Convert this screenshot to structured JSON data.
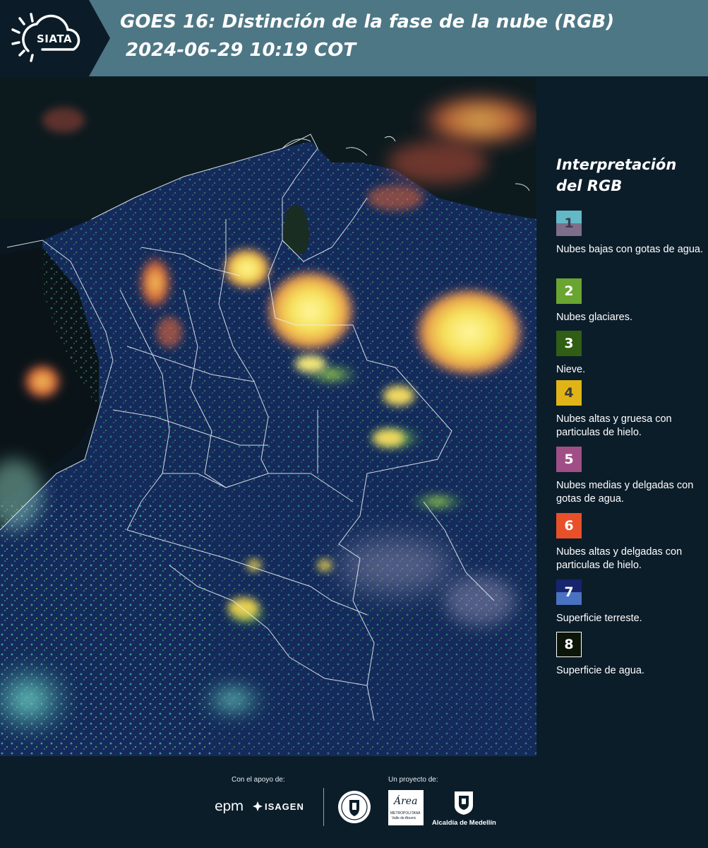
{
  "header": {
    "logo_text": "SIATA",
    "title": "GOES 16: Distinción de la fase de la nube (RGB)",
    "subtitle": "2024-06-29 10:19 COT"
  },
  "legend": {
    "title_line1": "Interpretación",
    "title_line2": "del RGB",
    "items": [
      {
        "number": "1",
        "label": "Nubes bajas con gotas de agua.",
        "color": "#64b9c6",
        "color2": "#7d6e8a"
      },
      {
        "number": "2",
        "label": "Nubes glaciares.",
        "color": "#6aa431"
      },
      {
        "number": "3",
        "label": "Nieve.",
        "color": "#2f5e14"
      },
      {
        "number": "4",
        "label": "Nubes altas y gruesa con particulas de hielo.",
        "color": "#e0b417"
      },
      {
        "number": "5",
        "label": "Nubes medias y delgadas con gotas de agua.",
        "color": "#a04f86"
      },
      {
        "number": "6",
        "label": "Nubes altas y delgadas con particulas de hielo.",
        "color": "#e8502a"
      },
      {
        "number": "7",
        "label": "Superficie terreste.",
        "color": "#16256e",
        "color2": "#4a72c2"
      },
      {
        "number": "8",
        "label": "Superficie de agua.",
        "color": "#0b1608"
      }
    ]
  },
  "footer": {
    "support_caption": "Con el apoyo de:",
    "project_caption": "Un proyecto de:",
    "epm": "epm",
    "isagen": "ISAGEN",
    "area_name": "Área",
    "area_sub1": "METROPOLITANA",
    "area_sub2": "Valle de Aburrá",
    "alcaldia": "Alcaldía de Medellín"
  },
  "colors": {
    "header_bg": "#4e7785",
    "panel_bg": "#0c1d2a"
  }
}
